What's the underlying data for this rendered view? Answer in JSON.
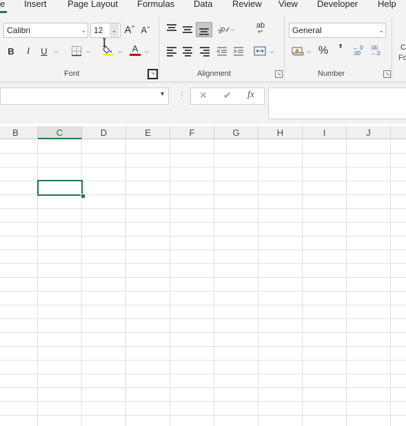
{
  "tabs": {
    "home_fragment": "e",
    "insert": "Insert",
    "page_layout": "Page Layout",
    "formulas": "Formulas",
    "data": "Data",
    "review": "Review",
    "view": "View",
    "developer": "Developer",
    "help": "Help"
  },
  "ribbon": {
    "font_group": {
      "label": "Font",
      "font_name": "Calibri",
      "font_size": "12",
      "bold": "B",
      "italic": "I",
      "underline": "U",
      "increase_size": "Aˆ",
      "decrease_size": "Aˇ",
      "font_color": "A",
      "font_color_hex": "#c00000",
      "highlight_color_hex": "#ffff00"
    },
    "alignment_group": {
      "label": "Alignment",
      "wrap_text": "ab"
    },
    "number_group": {
      "label": "Number",
      "format": "General",
      "percent": "%",
      "comma": "’",
      "increase_decimal": "←.0 .00",
      "decrease_decimal": ".00 →.0"
    },
    "styles_partial": {
      "line1": "C",
      "line2": "Fo"
    }
  },
  "formula_bar": {
    "name_box_value": "",
    "cancel": "✕",
    "enter": "✔",
    "fx": "fx",
    "formula_value": ""
  },
  "sheet": {
    "columns": [
      "B",
      "C",
      "D",
      "E",
      "F",
      "G",
      "H",
      "I",
      "J"
    ],
    "selected_column": "C",
    "accent_hex": "#217346"
  }
}
